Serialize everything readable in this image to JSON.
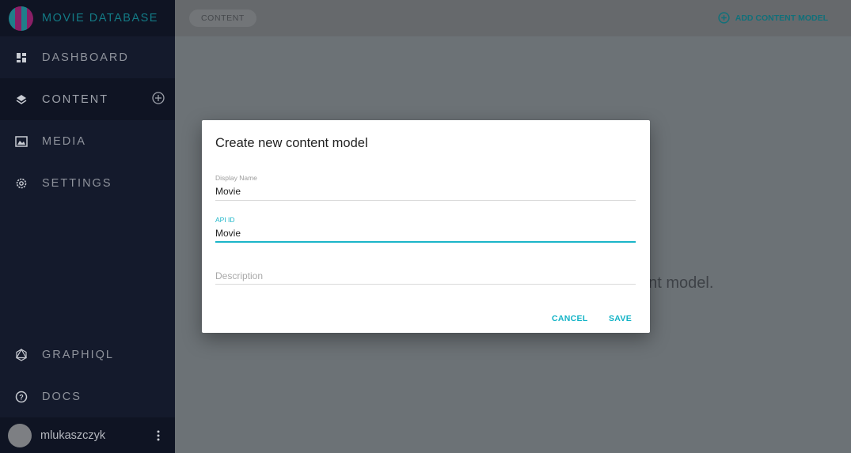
{
  "app": {
    "title": "MOVIE DATABASE"
  },
  "sidebar": {
    "items": [
      {
        "label": "DASHBOARD",
        "icon": "dashboard-icon"
      },
      {
        "label": "CONTENT",
        "icon": "layers-icon",
        "active": true
      },
      {
        "label": "MEDIA",
        "icon": "image-icon"
      },
      {
        "label": "SETTINGS",
        "icon": "gear-icon"
      }
    ],
    "bottom_items": [
      {
        "label": "GRAPHIQL",
        "icon": "graphql-icon"
      },
      {
        "label": "DOCS",
        "icon": "help-circle-icon"
      }
    ],
    "user": {
      "name": "mlukaszczyk"
    }
  },
  "header": {
    "breadcrumb": "CONTENT",
    "add_button": "ADD CONTENT MODEL",
    "accent": "#1bb5c8"
  },
  "background": {
    "message_fragment": "ent model."
  },
  "dialog": {
    "title": "Create new content model",
    "fields": {
      "display_name": {
        "label": "Display Name",
        "value": "Movie"
      },
      "api_id": {
        "label": "API ID",
        "value": "Movie"
      },
      "description": {
        "placeholder": "Description",
        "value": ""
      }
    },
    "cancel": "CANCEL",
    "save": "SAVE"
  }
}
